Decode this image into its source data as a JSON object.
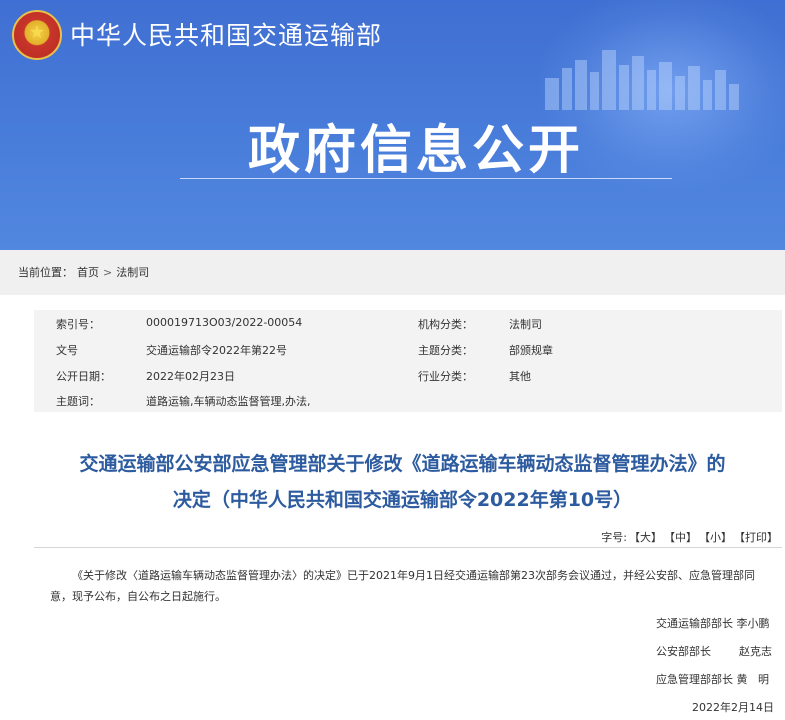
{
  "header": {
    "ministry_name": "中华人民共和国交通运输部",
    "section_title": "政府信息公开"
  },
  "breadcrumb": {
    "label": "当前位置：",
    "items": [
      "首页",
      "法制司"
    ],
    "separator": ">"
  },
  "meta": {
    "index_label": "索引号：",
    "index_value": "000019713O03/2022-00054",
    "org_label": "机构分类：",
    "org_value": "法制司",
    "doc_label": "文号",
    "doc_value": "交通运输部令2022年第22号",
    "topic_label": "主题分类：",
    "topic_value": "部颁规章",
    "date_label": "公开日期：",
    "date_value": "2022年02月23日",
    "industry_label": "行业分类：",
    "industry_value": "其他",
    "keywords_label": "主题词：",
    "keywords_value": "道路运输,车辆动态监督管理,办法,"
  },
  "article": {
    "title_line1": "交通运输部公安部应急管理部关于修改《道路运输车辆动态监督管理办法》的",
    "title_line2": "决定（中华人民共和国交通运输部令2022年第10号）",
    "font_label": "字号:",
    "font_large": "【大】",
    "font_medium": "【中】",
    "font_small": "【小】",
    "print": "【打印】",
    "body": "《关于修改〈道路运输车辆动态监督管理办法〉的决定》已于2021年9月1日经交通运输部第23次部务会议通过，并经公安部、应急管理部同意，现予公布，自公布之日起施行。",
    "signatures": [
      "交通运输部部长 李小鹏",
      "公安部部长        赵克志",
      "应急管理部部长 黄   明"
    ],
    "date": "2022年2月14日"
  },
  "colors": {
    "banner": "#4a7edb",
    "title": "#2d5b9f",
    "meta_bg": "#f3f3f3",
    "crumb_bg": "#f0f0f0"
  }
}
